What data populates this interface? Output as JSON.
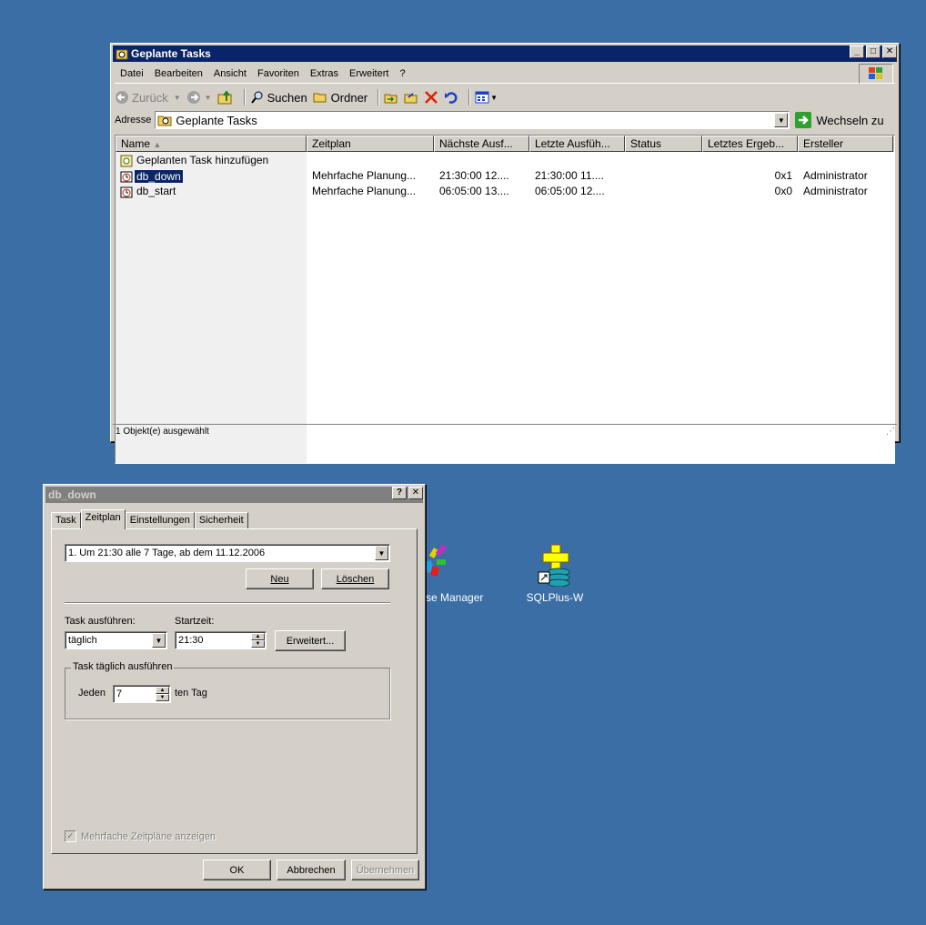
{
  "explorer": {
    "title": "Geplante Tasks",
    "menu": [
      "Datei",
      "Bearbeiten",
      "Ansicht",
      "Favoriten",
      "Extras",
      "Erweitert",
      "?"
    ],
    "toolbar": {
      "back": "Zurück",
      "search": "Suchen",
      "folders": "Ordner"
    },
    "address_label": "Adresse",
    "address_value": "Geplante Tasks",
    "go_label": "Wechseln zu",
    "columns": [
      "Name",
      "Zeitplan",
      "Nächste Ausf...",
      "Letzte Ausfüh...",
      "Status",
      "Letztes Ergeb...",
      "Ersteller"
    ],
    "rows": [
      {
        "name": "Geplanten Task hinzufügen",
        "schedule": "",
        "next": "",
        "last": "",
        "status": "",
        "result": "",
        "creator": ""
      },
      {
        "name": "db_down",
        "schedule": "Mehrfache Planung...",
        "next": "21:30:00  12....",
        "last": "21:30:00  11....",
        "status": "",
        "result": "0x1",
        "creator": "Administrator"
      },
      {
        "name": "db_start",
        "schedule": "Mehrfache Planung...",
        "next": "06:05:00  13....",
        "last": "06:05:00  12....",
        "status": "",
        "result": "0x0",
        "creator": "Administrator"
      }
    ],
    "statusbar": "1 Objekt(e) ausgewählt"
  },
  "dialog": {
    "title": "db_down",
    "tabs": [
      "Task",
      "Zeitplan",
      "Einstellungen",
      "Sicherheit"
    ],
    "selected_tab": "Zeitplan",
    "schedule_select": "1. Um 21:30 alle 7 Tage, ab dem 11.12.2006",
    "new_button": "Neu",
    "delete_button": "Löschen",
    "run_label": "Task ausführen:",
    "start_label": "Startzeit:",
    "run_value": "täglich",
    "start_value": "21:30",
    "advanced_button": "Erweitert...",
    "group_label": "Task täglich ausführen",
    "every_label": "Jeden",
    "every_value": "7",
    "day_label": "ten Tag",
    "multi_checkbox": "Mehrfache Zeitpläne anzeigen",
    "ok": "OK",
    "cancel": "Abbrechen",
    "apply": "Übernehmen"
  },
  "desktop": {
    "icon1_label": "se Manager",
    "icon2_label": "SQLPlus-W"
  }
}
